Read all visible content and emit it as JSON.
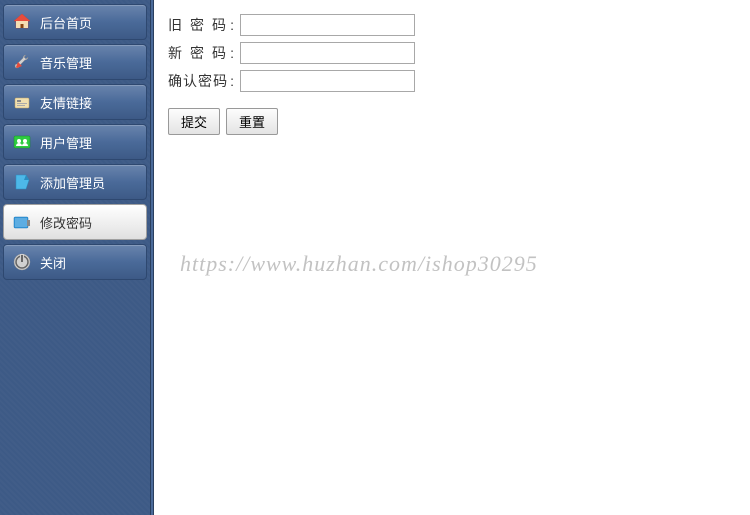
{
  "sidebar": {
    "items": [
      {
        "label": "后台首页",
        "icon": "home-icon",
        "active": false
      },
      {
        "label": "音乐管理",
        "icon": "wrench-icon",
        "active": false
      },
      {
        "label": "友情链接",
        "icon": "link-icon",
        "active": false
      },
      {
        "label": "用户管理",
        "icon": "users-icon",
        "active": false
      },
      {
        "label": "添加管理员",
        "icon": "add-admin-icon",
        "active": false
      },
      {
        "label": "修改密码",
        "icon": "password-icon",
        "active": true
      },
      {
        "label": "关闭",
        "icon": "power-icon",
        "active": false
      }
    ]
  },
  "form": {
    "old_password_label": "旧 密 码",
    "new_password_label": "新 密 码",
    "confirm_password_label": "确认密码",
    "old_password_value": "",
    "new_password_value": "",
    "confirm_password_value": "",
    "submit_label": "提交",
    "reset_label": "重置"
  },
  "watermark": "https://www.huzhan.com/ishop30295"
}
